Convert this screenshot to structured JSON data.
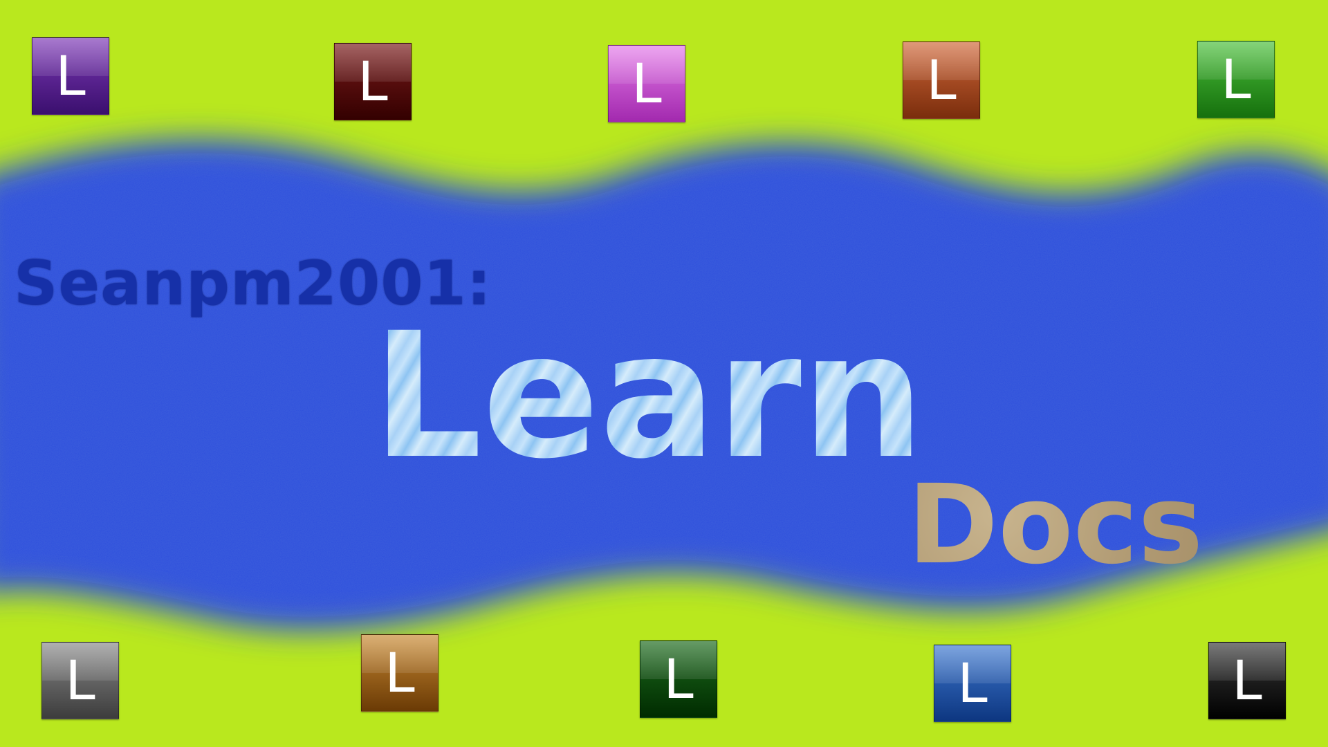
{
  "colors": {
    "background_green": "#b9e81e",
    "band_blue": "#2e4fdc",
    "small_heading": "#1630a8",
    "main_heading": "#b7dcf7",
    "sub_heading": "#b9a47f"
  },
  "headings": {
    "small": "Seanpm2001:",
    "main": "Learn",
    "sub": "Docs"
  },
  "top_tiles": [
    {
      "letter": "L",
      "icon": "purple-l-tile-icon",
      "color_top": "#7e3ab6",
      "color_bottom": "#3a0f6e"
    },
    {
      "letter": "L",
      "icon": "maroon-l-tile-icon",
      "color_top": "#7a1a1a",
      "color_bottom": "#330000"
    },
    {
      "letter": "L",
      "icon": "magenta-l-tile-icon",
      "color_top": "#e37be8",
      "color_bottom": "#a229ae"
    },
    {
      "letter": "L",
      "icon": "rust-l-tile-icon",
      "color_top": "#d0683a",
      "color_bottom": "#7a2d0c"
    },
    {
      "letter": "L",
      "icon": "green-l-tile-icon",
      "color_top": "#4bbf3b",
      "color_bottom": "#16700d"
    }
  ],
  "bottom_tiles": [
    {
      "letter": "L",
      "icon": "gray-l-tile-icon",
      "color_top": "#8a8a8a",
      "color_bottom": "#3c3c3c"
    },
    {
      "letter": "L",
      "icon": "amber-l-tile-icon",
      "color_top": "#c98a33",
      "color_bottom": "#6a3a05"
    },
    {
      "letter": "L",
      "icon": "dark-green-l-tile-icon",
      "color_top": "#1d6b1d",
      "color_bottom": "#002b00"
    },
    {
      "letter": "L",
      "icon": "blue-l-tile-icon",
      "color_top": "#3f79cf",
      "color_bottom": "#0d3680"
    },
    {
      "letter": "L",
      "icon": "black-l-tile-icon",
      "color_top": "#3a3a3a",
      "color_bottom": "#000000"
    }
  ]
}
